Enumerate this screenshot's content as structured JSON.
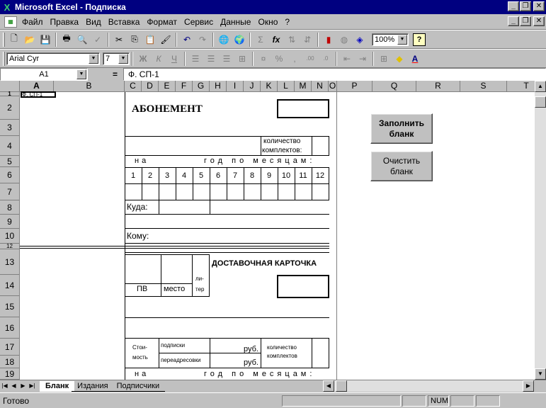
{
  "window": {
    "title": "Microsoft Excel - Подписка",
    "app_icon": "excel-icon"
  },
  "menu": [
    "Файл",
    "Правка",
    "Вид",
    "Вставка",
    "Формат",
    "Сервис",
    "Данные",
    "Окно",
    "?"
  ],
  "toolbar": {
    "zoom": "100%",
    "font_name": "Arial Cyr",
    "font_size": "7",
    "sum_symbol": "Σ",
    "fx_symbol": "fx"
  },
  "formula_bar": {
    "cell_ref": "A1",
    "equals": "=",
    "formula": "Ф. СП-1"
  },
  "columns": [
    "A",
    "B",
    "C",
    "D",
    "E",
    "F",
    "G",
    "H",
    "I",
    "J",
    "K",
    "L",
    "M",
    "N",
    "O",
    "P",
    "Q",
    "R",
    "S",
    "T"
  ],
  "rows": [
    "1",
    "2",
    "3",
    "4",
    "5",
    "6",
    "7",
    "8",
    "9",
    "10",
    "11",
    "12",
    "13",
    "14",
    "15",
    "16",
    "17",
    "18",
    "19"
  ],
  "sheet": {
    "a1": "Ф. СП-1",
    "abonement": "АБОНЕМЕНТ",
    "kolichestvo": "количество",
    "komplektov": "комплектов:",
    "na": "на",
    "god_po_mesyacam": "год по месяцам:",
    "months": [
      "1",
      "2",
      "3",
      "4",
      "5",
      "6",
      "7",
      "8",
      "9",
      "10",
      "11",
      "12"
    ],
    "kuda": "Куда:",
    "komu": "Кому:",
    "dostavochnaya": "ДОСТАВОЧНАЯ КАРТОЧКА",
    "pv": "ПВ",
    "mesto": "место",
    "li": "ли-",
    "ter": "тер",
    "stoi": "Стои-",
    "most": "мость",
    "podpiski": "подписки",
    "pereadresovki": "переадресовки",
    "rub": "руб.",
    "kolichestvo2": "количество",
    "komplektov2": "комплектов"
  },
  "buttons": {
    "fill": "Заполнить бланк",
    "clear": "Очистить бланк"
  },
  "tabs": [
    "Бланк",
    "Издания",
    "Подписчики"
  ],
  "status": {
    "ready": "Готово",
    "num": "NUM"
  }
}
